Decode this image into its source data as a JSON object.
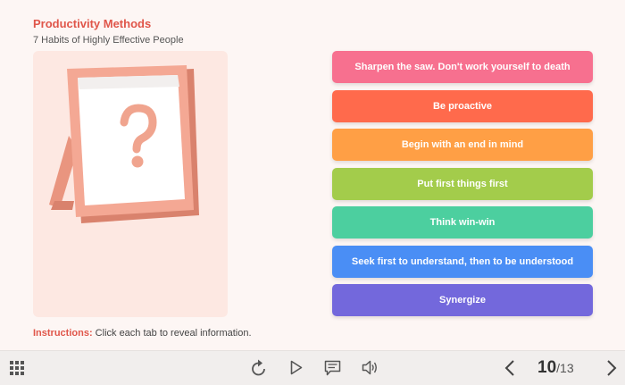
{
  "header": {
    "title": "Productivity Methods",
    "subtitle": "7 Habits of Highly Effective People"
  },
  "image": {
    "icon": "question-mark-frame"
  },
  "instructions": {
    "label": "Instructions:",
    "text": " Click each tab to reveal information."
  },
  "tabs": [
    {
      "label": "Sharpen the saw. Don't work yourself to death",
      "color": "#f7708f"
    },
    {
      "label": "Be proactive",
      "color": "#ff6a4c"
    },
    {
      "label": "Begin with an end in mind",
      "color": "#ff9f45"
    },
    {
      "label": "Put first things first",
      "color": "#a3cc4b"
    },
    {
      "label": "Think win-win",
      "color": "#4ccf9f"
    },
    {
      "label": "Seek first to understand, then to be understood",
      "color": "#4a8ef5"
    },
    {
      "label": "Synergize",
      "color": "#7368dc"
    }
  ],
  "toolbar": {
    "icons": [
      "menu-grid-icon",
      "replay-icon",
      "play-icon",
      "notes-icon",
      "volume-icon",
      "prev-arrow-icon",
      "next-arrow-icon"
    ],
    "current_page": "10",
    "total_pages": "/13"
  }
}
